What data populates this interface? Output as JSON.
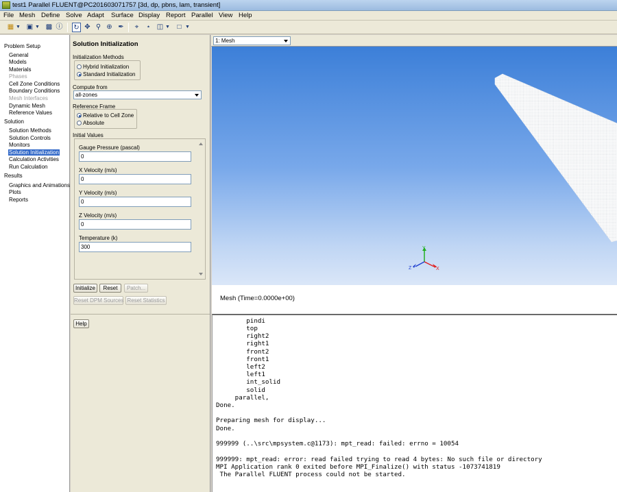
{
  "window": {
    "title": "test1 Parallel FLUENT@PC201603071757  [3d, dp, pbns, lam, transient]"
  },
  "menu": [
    "File",
    "Mesh",
    "Define",
    "Solve",
    "Adapt",
    "Surface",
    "Display",
    "Report",
    "Parallel",
    "View",
    "Help"
  ],
  "toolbar": {
    "icons": [
      "open-icon",
      "dropdown-icon",
      "save-icon",
      "dropdown-icon",
      "print-icon",
      "help-icon",
      "rotate-icon",
      "pan-icon",
      "zoom-icon",
      "zoom-in-icon",
      "probe-icon",
      "zoom-fit-icon",
      "axes-icon",
      "layout-icon",
      "dropdown-icon",
      "viewport-icon",
      "dropdown-icon"
    ]
  },
  "tree": {
    "sections": [
      {
        "label": "Problem Setup",
        "items": [
          {
            "label": "General",
            "state": "normal"
          },
          {
            "label": "Models",
            "state": "normal"
          },
          {
            "label": "Materials",
            "state": "normal"
          },
          {
            "label": "Phases",
            "state": "disabled"
          },
          {
            "label": "Cell Zone Conditions",
            "state": "normal"
          },
          {
            "label": "Boundary Conditions",
            "state": "normal"
          },
          {
            "label": "Mesh Interfaces",
            "state": "disabled"
          },
          {
            "label": "Dynamic Mesh",
            "state": "normal"
          },
          {
            "label": "Reference Values",
            "state": "normal"
          }
        ]
      },
      {
        "label": "Solution",
        "items": [
          {
            "label": "Solution Methods",
            "state": "normal"
          },
          {
            "label": "Solution Controls",
            "state": "normal"
          },
          {
            "label": "Monitors",
            "state": "normal"
          },
          {
            "label": "Solution Initialization",
            "state": "selected"
          },
          {
            "label": "Calculation Activities",
            "state": "normal"
          },
          {
            "label": "Run Calculation",
            "state": "normal"
          }
        ]
      },
      {
        "label": "Results",
        "items": [
          {
            "label": "Graphics and Animations",
            "state": "normal"
          },
          {
            "label": "Plots",
            "state": "normal"
          },
          {
            "label": "Reports",
            "state": "normal"
          }
        ]
      }
    ]
  },
  "panel": {
    "title": "Solution Initialization",
    "init_methods_label": "Initialization Methods",
    "init_methods": [
      {
        "label": "Hybrid  Initialization",
        "checked": false
      },
      {
        "label": "Standard Initialization",
        "checked": true
      }
    ],
    "compute_from_label": "Compute from",
    "compute_from_value": "all-zones",
    "ref_frame_label": "Reference Frame",
    "ref_frames": [
      {
        "label": "Relative to Cell Zone",
        "checked": true
      },
      {
        "label": "Absolute",
        "checked": false
      }
    ],
    "initial_values_label": "Initial Values",
    "fields": [
      {
        "label": "Gauge Pressure (pascal)",
        "value": "0"
      },
      {
        "label": "X Velocity (m/s)",
        "value": "0"
      },
      {
        "label": "Y Velocity (m/s)",
        "value": "0"
      },
      {
        "label": "Z Velocity (m/s)",
        "value": "0"
      },
      {
        "label": "Temperature (k)",
        "value": "300"
      }
    ],
    "buttons": {
      "initialize": "Initialize",
      "reset": "Reset",
      "patch": "Patch...",
      "reset_dpm": "Reset DPM Sources",
      "reset_stats": "Reset Statistics",
      "help": "Help"
    }
  },
  "graphics": {
    "window_select": "1: Mesh",
    "caption": "Mesh  (Time=0.0000e+00)",
    "axes": {
      "x": "X",
      "y": "Y",
      "z": "Z"
    },
    "colors": {
      "axis_x": "#e02020",
      "axis_y": "#20b020",
      "axis_z": "#2040d0"
    }
  },
  "console": {
    "lines": [
      "        pindi",
      "        top",
      "        right2",
      "        right1",
      "        front2",
      "        front1",
      "        left2",
      "        left1",
      "        int_solid",
      "        solid",
      "     parallel,",
      "Done.",
      "",
      "Preparing mesh for display...",
      "Done.",
      "",
      "999999 (..\\src\\mpsystem.c@1173): mpt_read: failed: errno = 10054",
      "",
      "999999: mpt_read: error: read failed trying to read 4 bytes: No such file or directory",
      "MPI Application rank 0 exited before MPI_Finalize() with status -1073741819",
      " The Parallel FLUENT process could not be started."
    ]
  }
}
